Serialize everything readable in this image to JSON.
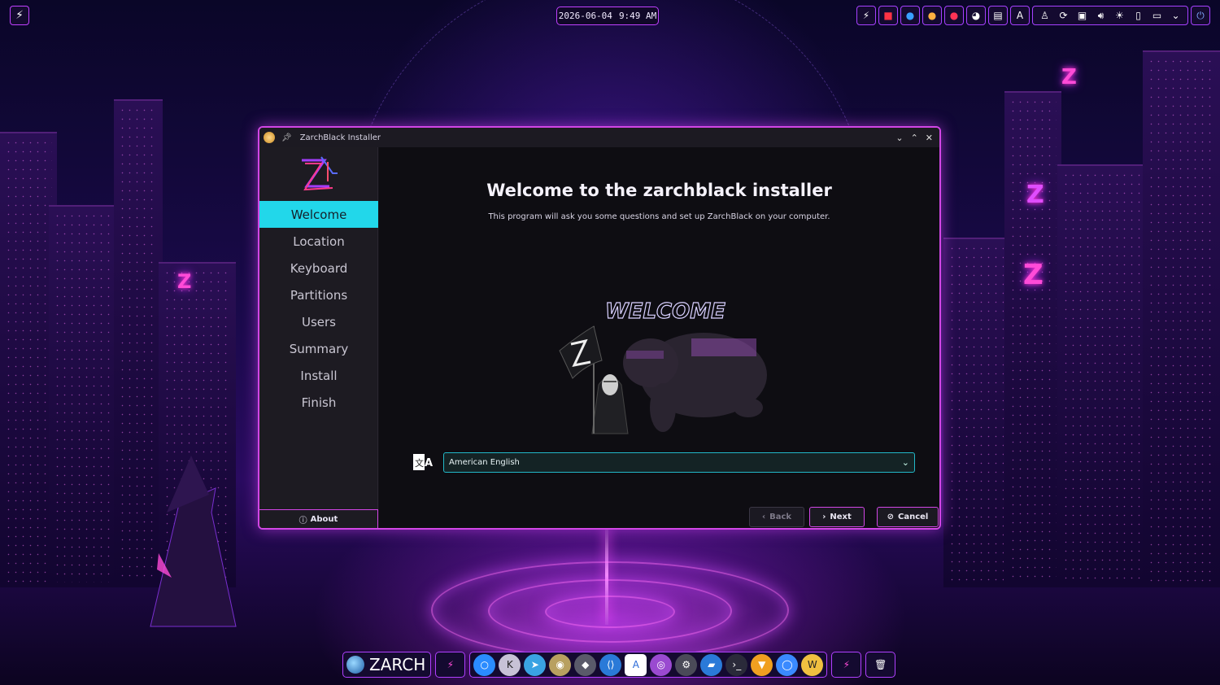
{
  "topbar": {
    "date": "2026-06-04",
    "time": "9:49 AM"
  },
  "window": {
    "title": "ZarchBlack Installer"
  },
  "sidebar": {
    "items": [
      {
        "label": "Welcome",
        "active": true
      },
      {
        "label": "Location",
        "active": false
      },
      {
        "label": "Keyboard",
        "active": false
      },
      {
        "label": "Partitions",
        "active": false
      },
      {
        "label": "Users",
        "active": false
      },
      {
        "label": "Summary",
        "active": false
      },
      {
        "label": "Install",
        "active": false
      },
      {
        "label": "Finish",
        "active": false
      }
    ],
    "about_label": "About"
  },
  "main": {
    "heading": "Welcome to the zarchblack installer",
    "subtitle": "This program will ask you some questions and set up ZarchBlack on your computer.",
    "art_text": "WELCOME",
    "language": {
      "selected": "American English"
    }
  },
  "buttons": {
    "back": "Back",
    "next": "Next",
    "cancel": "Cancel"
  },
  "dock": {
    "brand": "ZARCH"
  },
  "colors": {
    "accent_pink": "#d246e6",
    "accent_cyan": "#22d7ea"
  }
}
